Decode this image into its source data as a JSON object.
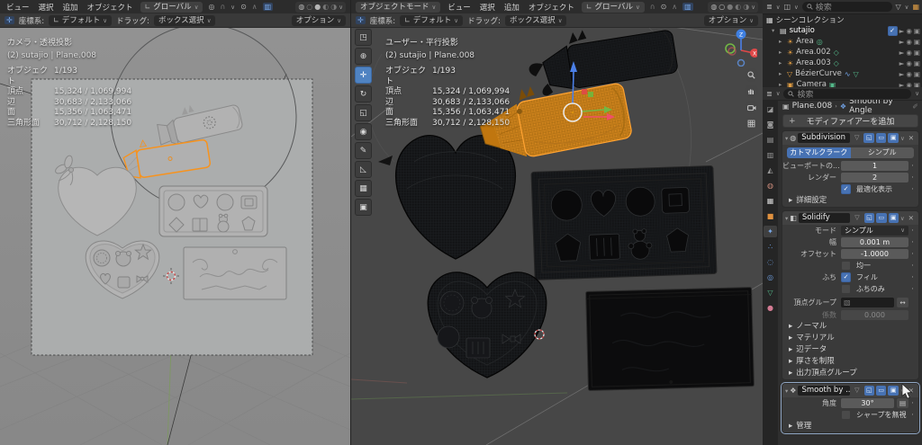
{
  "colors": {
    "accent_blue": "#4772b3",
    "selection_orange": "#ffa332",
    "axis_x": "#ef5068",
    "axis_y": "#73b844",
    "axis_z": "#4b80e8",
    "candy_orange": "#d8891f"
  },
  "g": {
    "chev": "∨",
    "dd": "▾",
    "exp": "▸",
    "x": "✕",
    "plus": "+",
    "dot": "·",
    "sep": "›",
    "check": "✓",
    "t_select": "◳",
    "t_cursor": "⊕",
    "t_move": "✛",
    "t_rotate": "↻",
    "t_scale": "◱",
    "t_xform": "◉",
    "t_annot": "✎",
    "t_meas": "◺",
    "t_cube": "▦",
    "t_extra": "▣",
    "h_orient": "∟",
    "h_pivot": "◎",
    "h_magnet": "∩",
    "h_prop": "⊙",
    "h_fall": "∧",
    "h_xray": "▥",
    "h_ovl": "◍",
    "h_wire": "○",
    "h_solid": "●",
    "h_mat": "◐",
    "h_rend": "◑",
    "tb_tool": "◪",
    "tb_render": "◙",
    "tb_out": "▤",
    "tb_vl": "▥",
    "tb_scene": "◭",
    "tb_world": "◍",
    "tb_coll": "▦",
    "tb_obj": "■",
    "tb_mod": "✦",
    "tb_part": "∴",
    "tb_phys": "◌",
    "tb_con": "◎",
    "tb_data": "▽",
    "tb_mat": "●",
    "ol_ed": "≣",
    "ol_disp": "◫",
    "ol_fun": "▽",
    "ol_new": "▦",
    "ol_sc": "▦",
    "ol_col": "▤",
    "ol_light": "☀",
    "ol_curve": "∿",
    "ol_cam": "▣",
    "ol_ptr": "►",
    "ol_eye": "◉",
    "ol_ctg": "▣",
    "d_a1": "◎",
    "d_a2": "◇",
    "d_cb": "∿",
    "d_cg": "▽",
    "d_cam": "▣",
    "pr_ed": "≣",
    "pin": "✐",
    "bc_obj_ic": "▣",
    "bc_mod_ic": "❖",
    "m_cage": "▽",
    "m_edit": "◱",
    "m_view": "▭",
    "m_rend": "▣",
    "ic_sub": "◍",
    "ic_sol": "◧",
    "ic_smooth": "❖",
    "vg": "▧",
    "swap": "↔",
    "dec": "▤"
  },
  "lv": {
    "menus": [
      "ビュー",
      "選択",
      "追加",
      "オブジェクト"
    ],
    "orientation": "グローバル",
    "view": "カメラ・透視投影",
    "ctx": "(2) sutajio | Plane.008",
    "stats": [
      {
        "l": "オブジェクト",
        "v": "1/193"
      },
      {
        "l": "頂点",
        "v": "15,324 / 1,069,994"
      },
      {
        "l": "辺",
        "v": "30,683 / 2,133,066"
      },
      {
        "l": "面",
        "v": "15,356 / 1,063,471"
      },
      {
        "l": "三角形面",
        "v": "30,712 / 2,128,150"
      }
    ],
    "ts": {
      "coord": "座標系:",
      "coord_v": "デフォルト",
      "drag": "ドラッグ:",
      "drag_v": "ボックス選択",
      "opt": "オプション"
    }
  },
  "cv": {
    "mode": "オブジェクトモード",
    "menus": [
      "ビュー",
      "選択",
      "追加",
      "オブジェクト"
    ],
    "orientation": "グローバル",
    "view": "ユーザー・平行投影",
    "ctx": "(2) sutajio | Plane.008",
    "stats": [
      {
        "l": "オブジェクト",
        "v": "1/193"
      },
      {
        "l": "頂点",
        "v": "15,324 / 1,069,994"
      },
      {
        "l": "辺",
        "v": "30,683 / 2,133,066"
      },
      {
        "l": "面",
        "v": "15,356 / 1,063,471"
      },
      {
        "l": "三角形面",
        "v": "30,712 / 2,128,150"
      }
    ],
    "ts": {
      "coord": "座標系:",
      "coord_v": "デフォルト",
      "drag": "ドラッグ:",
      "drag_v": "ボックス選択",
      "opt": "オプション"
    }
  },
  "ol": {
    "search": "検索",
    "scene": "シーンコレクション",
    "items": [
      "sutajio",
      "Area",
      "Area.002",
      "Area.003",
      "BézierCurve",
      "Camera"
    ]
  },
  "pr": {
    "search": "検索",
    "bc_obj": "Plane.008",
    "bc_mod": "Smooth by Angle",
    "add": "モディファイアーを追加",
    "sub": {
      "name": "Subdivision",
      "tab1": "カトマルクラーク",
      "tab2": "シンプル",
      "vp_l": "ビューポートの...",
      "vp_v": "1",
      "r_l": "レンダー",
      "r_v": "2",
      "opt": "最適化表示",
      "adv": "詳細設定"
    },
    "sol": {
      "name": "Solidify",
      "mode_l": "モード",
      "mode_v": "シンプル",
      "w_l": "幅",
      "w_v": "0.001 m",
      "o_l": "オフセット",
      "o_v": "-1.0000",
      "even": "均一",
      "rim_l": "ふち",
      "fill": "フィル",
      "rim_only": "ふちのみ",
      "vg_l": "頂点グループ",
      "f_l": "係数",
      "f_v": "0.000",
      "sections": [
        "ノーマル",
        "マテリアル",
        "辺データ",
        "厚さを制限",
        "出力頂点グループ"
      ]
    },
    "smooth": {
      "name": "Smooth by ...",
      "a_l": "角度",
      "a_v": "30°",
      "ignore": "シャープを無視",
      "manage": "管理"
    }
  }
}
